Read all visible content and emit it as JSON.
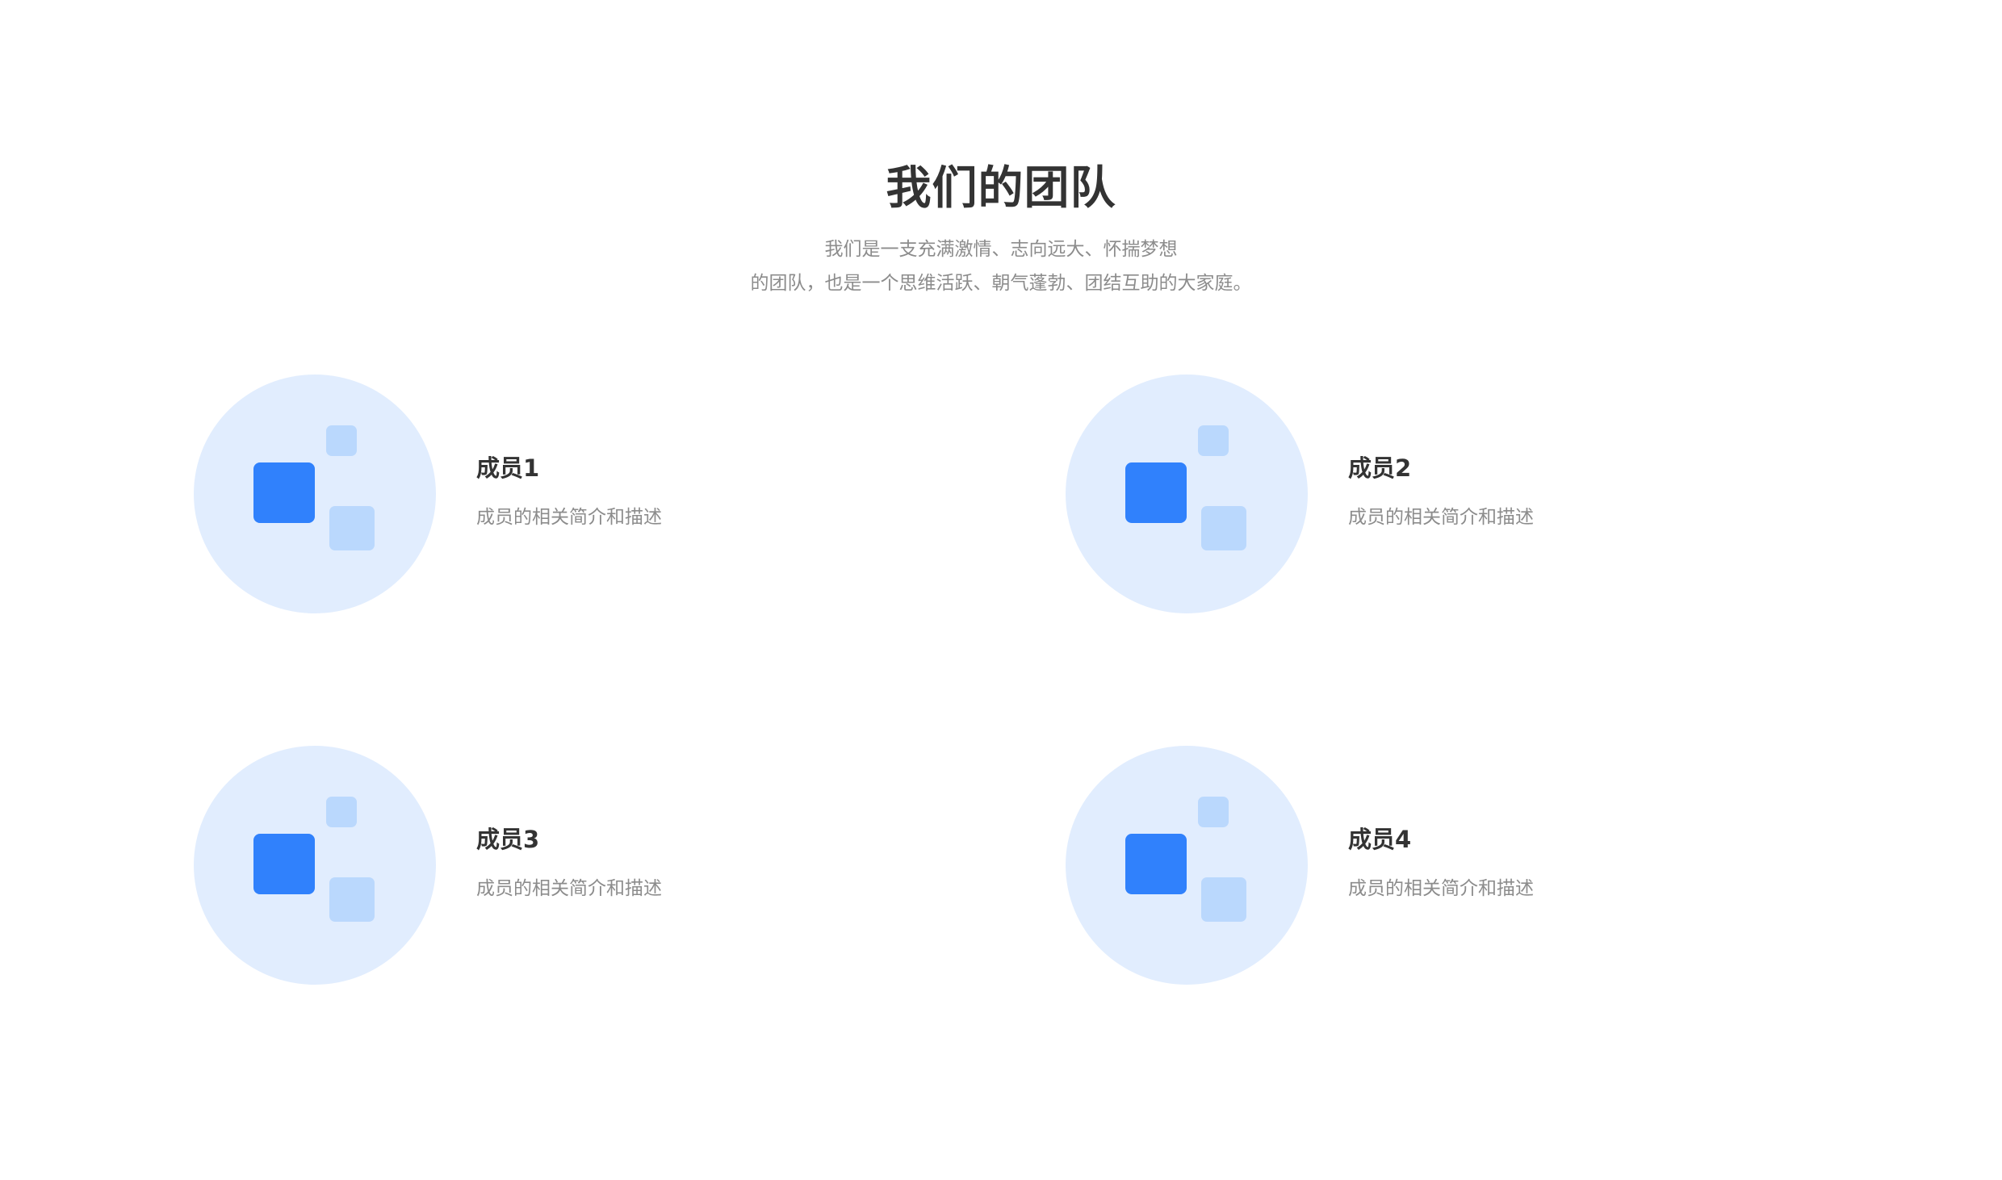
{
  "header": {
    "title": "我们的团队",
    "subtitle_line1": "我们是一支充满激情、志向远大、怀揣梦想",
    "subtitle_line2": "的团队，也是一个思维活跃、朝气蓬勃、团结互助的大家庭。"
  },
  "members": [
    {
      "name": "成员1",
      "description": "成员的相关简介和描述"
    },
    {
      "name": "成员2",
      "description": "成员的相关简介和描述"
    },
    {
      "name": "成员3",
      "description": "成员的相关简介和描述"
    },
    {
      "name": "成员4",
      "description": "成员的相关简介和描述"
    }
  ],
  "colors": {
    "avatar_bg": "#e1edfe",
    "accent": "#3081fc",
    "accent_light": "#bad8fd",
    "title": "#333333",
    "muted": "#8c8c8c"
  },
  "icons": {
    "avatar": "team-member-placeholder-icon"
  }
}
